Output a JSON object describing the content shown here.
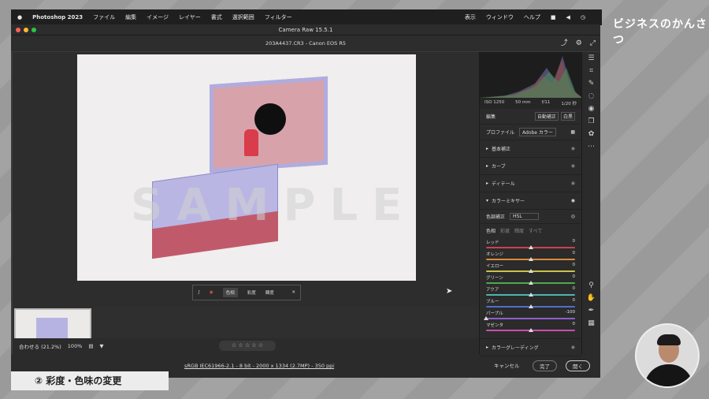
{
  "menubar": {
    "app_name": "Photoshop 2023",
    "items": [
      "ファイル",
      "編集",
      "イメージ",
      "レイヤー",
      "書式",
      "選択範囲",
      "フィルター"
    ],
    "right_items": [
      "表示",
      "ウィンドウ",
      "ヘルプ"
    ]
  },
  "window": {
    "title": "Camera Raw 15.5.1",
    "filename": "203A4437.CR3  -  Canon EOS R5"
  },
  "watermark": "SAMPLE",
  "hsl_toolbar": {
    "tabs": [
      "色相",
      "彩度",
      "輝度"
    ]
  },
  "bottom_bar": {
    "fit": "合わせる (21.2%)",
    "zoom": "100%",
    "stars": "☆ ☆ ☆ ☆ ☆"
  },
  "footer": {
    "info": "sRGB IEC61966-2.1 - 8 bit - 2000 x 1334 (2.7MP) - 350 ppi",
    "cancel": "キャンセル",
    "done": "完了",
    "open": "開く"
  },
  "panel": {
    "camera": [
      "ISO 1250",
      "50 mm",
      "f/11",
      "1/20 秒"
    ],
    "edit_label": "編集",
    "auto_label": "自動補正",
    "bw_label": "白黒",
    "profile_label": "プロファイル",
    "profile_value": "Adobe カラー",
    "sections": [
      "基本補正",
      "カーブ",
      "ディテール",
      "カラーミキサー"
    ],
    "mixer_label": "色調補正",
    "mixer_value": "HSL",
    "mixer_tabs": [
      "色相",
      "彩度",
      "輝度",
      "すべて"
    ],
    "sliders": [
      {
        "name": "レッド",
        "value": "0",
        "level": 0.5,
        "color": "#c9434b"
      },
      {
        "name": "オレンジ",
        "value": "0",
        "level": 0.5,
        "color": "#d88a3d"
      },
      {
        "name": "イエロー",
        "value": "0",
        "level": 0.5,
        "color": "#c9c34b"
      },
      {
        "name": "グリーン",
        "value": "0",
        "level": 0.5,
        "color": "#4fa84f"
      },
      {
        "name": "アクア",
        "value": "0",
        "level": 0.5,
        "color": "#4fb3b3"
      },
      {
        "name": "ブルー",
        "value": "0",
        "level": 0.5,
        "color": "#4f6fc9"
      },
      {
        "name": "パープル",
        "value": "-100",
        "level": 0.0,
        "color": "#8f5fc9"
      },
      {
        "name": "マゼンタ",
        "value": "0",
        "level": 0.5,
        "color": "#c94fae"
      }
    ],
    "grading_label": "カラーグレーディング"
  },
  "overlay_title": "② 彩度・色味の変更",
  "brand": "ビジネスのかんさつ"
}
